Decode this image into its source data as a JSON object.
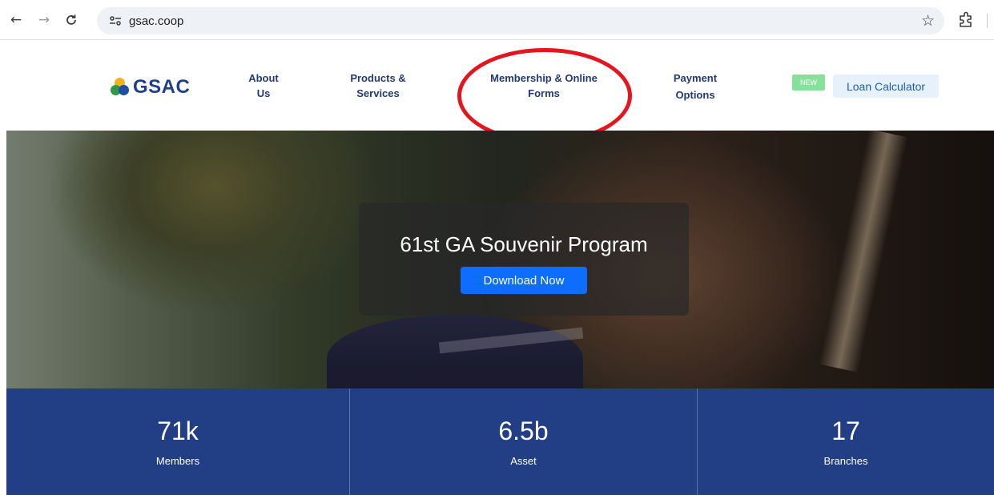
{
  "browser": {
    "back_glyph": "←",
    "forward_glyph": "→",
    "reload_glyph": "C",
    "site_info_glyph": "⚯",
    "url": "gsac.coop",
    "bookmark_glyph": "☆"
  },
  "header": {
    "logo_text": "GSAC",
    "nav": [
      {
        "line1": "About",
        "line2": "Us"
      },
      {
        "line1": "Products &",
        "line2": "Services"
      },
      {
        "line1": "Membership & Online",
        "line2": "Forms"
      },
      {
        "line1": "Payment",
        "line2": "Options"
      }
    ],
    "new_badge": "NEW",
    "loan_calculator": "Loan Calculator"
  },
  "hero": {
    "title": "61st GA Souvenir Program",
    "button": "Download Now"
  },
  "stats": [
    {
      "value": "71k",
      "label": "Members"
    },
    {
      "value": "6.5b",
      "label": "Asset"
    },
    {
      "value": "17",
      "label": "Branches"
    }
  ],
  "colors": {
    "brand_navy": "#223f86",
    "nav_text": "#233a72",
    "primary_button": "#0d6efd",
    "new_badge": "#86e29a",
    "annotation_red": "#e3151d"
  }
}
